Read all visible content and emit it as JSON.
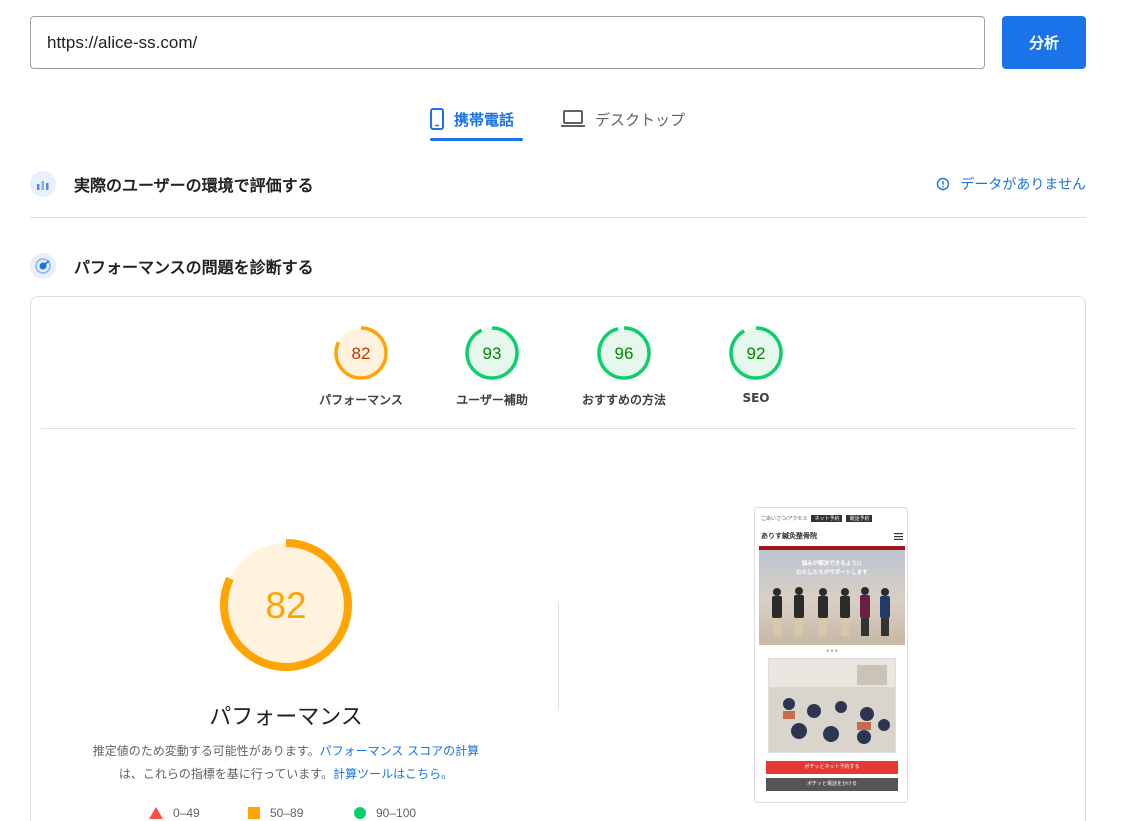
{
  "search": {
    "url_value": "https://alice-ss.com/",
    "analyze_label": "分析"
  },
  "tabs": [
    {
      "label": "携帯電話",
      "icon": "smartphone-icon",
      "active": true
    },
    {
      "label": "デスクトップ",
      "icon": "laptop-icon",
      "active": false
    }
  ],
  "field_data": {
    "title": "実際のユーザーの環境で評価する",
    "status_text": "データがありません",
    "status_icon": "info-icon"
  },
  "lab_data": {
    "title": "パフォーマンスの問題を診断する"
  },
  "scores": [
    {
      "label": "パフォーマンス",
      "value": "82",
      "color": "#ffa400",
      "text_color": "#c33300",
      "fraction": 0.82
    },
    {
      "label": "ユーザー補助",
      "value": "93",
      "color": "#0cce6b",
      "text_color": "#008800",
      "fraction": 0.93
    },
    {
      "label": "おすすめの方法",
      "value": "96",
      "color": "#0cce6b",
      "text_color": "#008800",
      "fraction": 0.96
    },
    {
      "label": "SEO",
      "value": "92",
      "color": "#0cce6b",
      "text_color": "#008800",
      "fraction": 0.92
    }
  ],
  "performance": {
    "score": "82",
    "title": "パフォーマンス",
    "desc_text1": "推定値のため変動する可能性があります。",
    "desc_link1": "パフォーマンス スコアの計算",
    "desc_text2": "は、これらの指標を基に行っています。",
    "desc_link2": "計算ツールはこちら。",
    "color": "#ffa400"
  },
  "legend": [
    {
      "range": "0–49",
      "shape": "triangle",
      "color": "#ff4e42"
    },
    {
      "range": "50–89",
      "shape": "square",
      "color": "#ffa400"
    },
    {
      "range": "90–100",
      "shape": "circle",
      "color": "#0cce6b"
    }
  ],
  "screenshot": {
    "topbar_text": "ごあいさつ/アクセス",
    "chip1": "ネット予約",
    "chip2": "電話予約",
    "brand": "ありす鍼灸整骨院",
    "hero_line1": "悩みが解決できるように",
    "hero_line2": "わたしたちがサポートします",
    "button_red": "ポチッとネット予約する",
    "button_gray": "ポチッと電話をかける"
  }
}
